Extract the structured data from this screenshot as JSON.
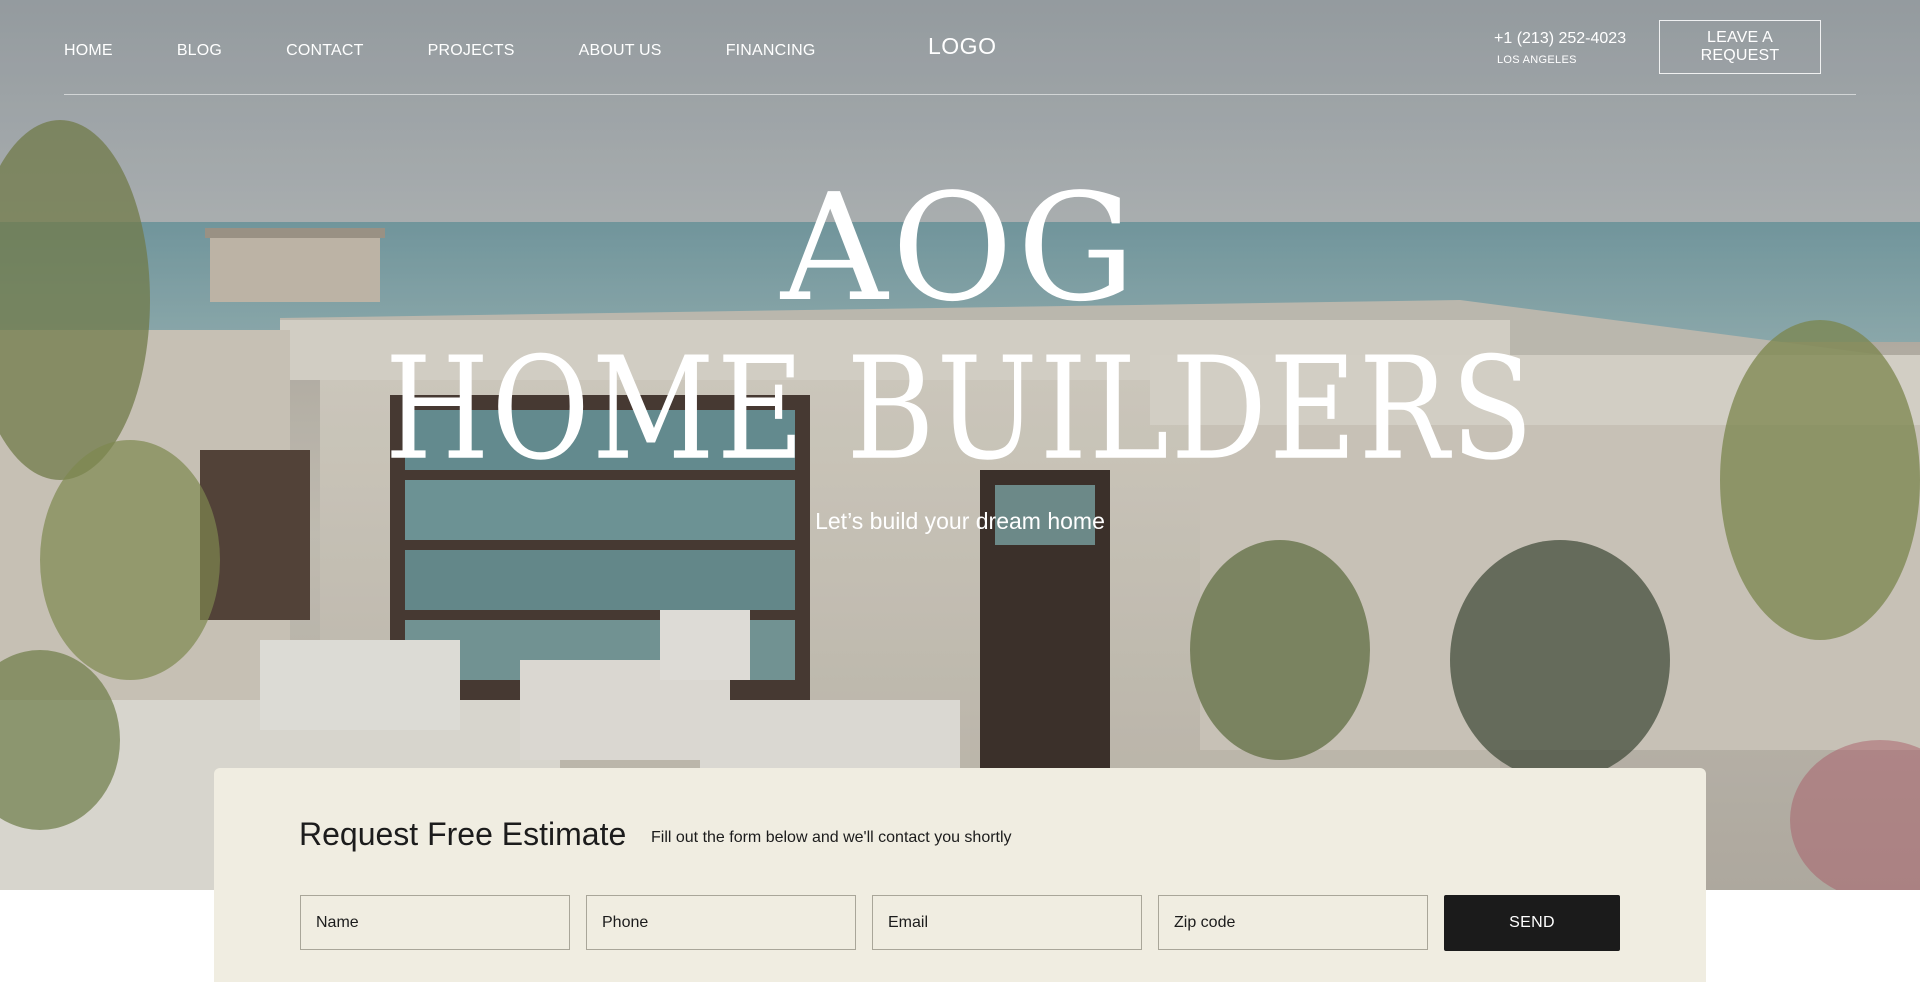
{
  "nav": {
    "items": [
      {
        "label": "HOME"
      },
      {
        "label": "BLOG"
      },
      {
        "label": "CONTACT"
      },
      {
        "label": "PROJECTS"
      },
      {
        "label": "ABOUT US"
      },
      {
        "label": "FINANCING"
      }
    ]
  },
  "header": {
    "logo": "LOGO",
    "phone": "+1 (213) 252-4023",
    "city": "LOS ANGELES",
    "cta_label": "LEAVE A REQUEST"
  },
  "hero": {
    "title_line1": "AOG",
    "title_line2": "HOME BUILDERS",
    "subtitle": "Let’s build your dream home",
    "image_subject": "modern-beach-house-photo"
  },
  "form": {
    "heading": "Request Free Estimate",
    "hint": "Fill out the form below and we'll contact you shortly",
    "fields": [
      {
        "placeholder": "Name",
        "value": ""
      },
      {
        "placeholder": "Phone",
        "value": ""
      },
      {
        "placeholder": "Email",
        "value": ""
      },
      {
        "placeholder": "Zip code",
        "value": ""
      }
    ],
    "submit_label": "SEND"
  },
  "colors": {
    "card_bg": "#f0ede1",
    "button_bg": "#1b1b1b",
    "header_text": "#ffffff"
  }
}
